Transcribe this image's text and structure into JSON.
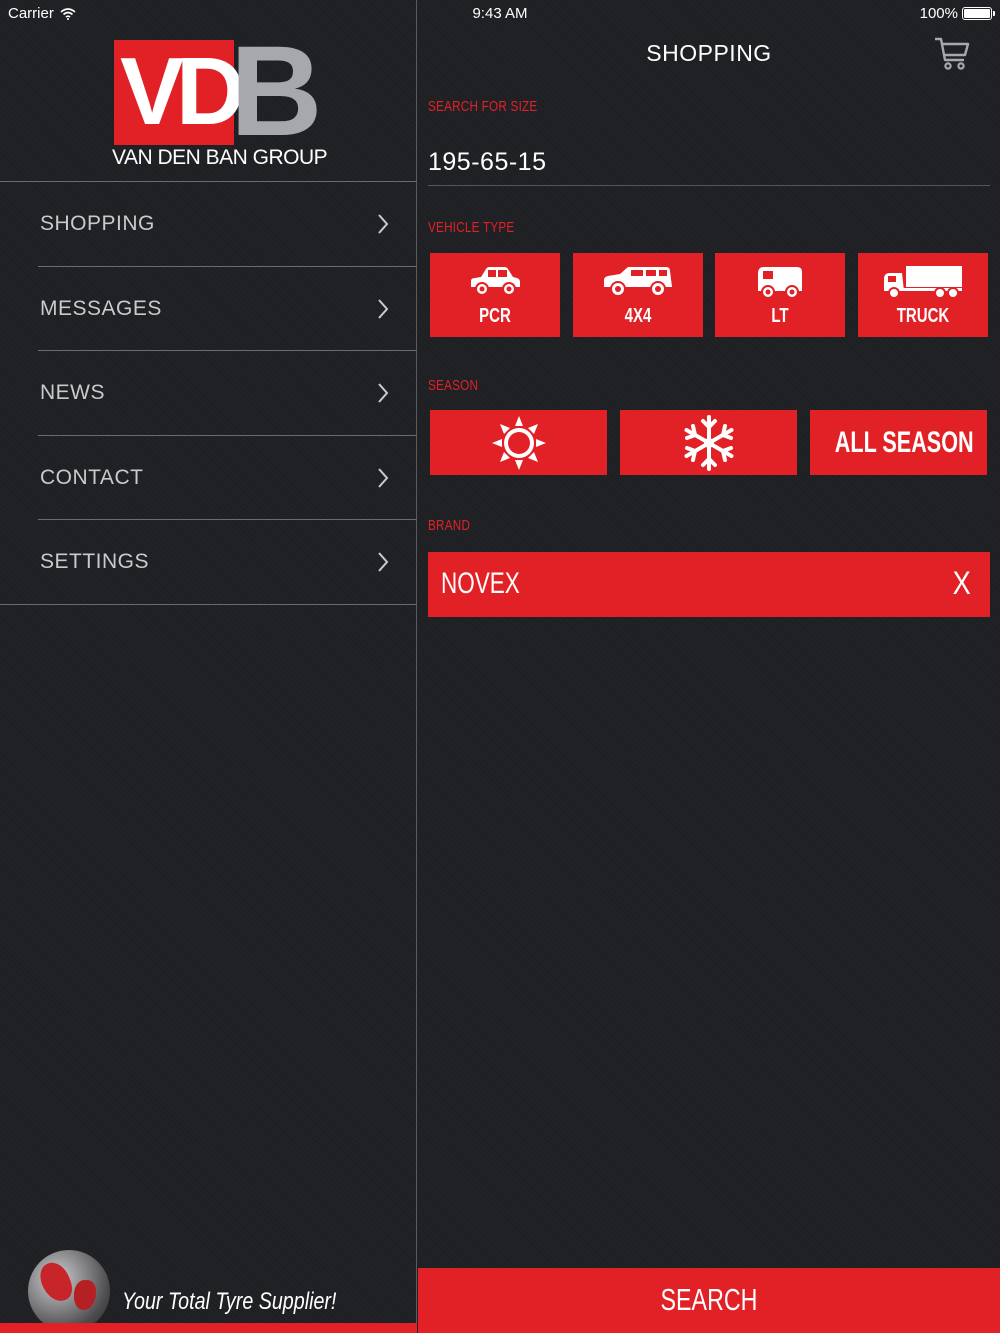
{
  "status_bar": {
    "carrier": "Carrier",
    "time": "9:43 AM",
    "battery": "100%"
  },
  "brand": {
    "logo_letters": "VDB",
    "group_name": "VAN DEN BAN GROUP",
    "tagline": "Your Total Tyre Supplier!",
    "accent_color": "#e22126"
  },
  "sidebar": {
    "items": [
      {
        "label": "SHOPPING"
      },
      {
        "label": "MESSAGES"
      },
      {
        "label": "NEWS"
      },
      {
        "label": "CONTACT"
      },
      {
        "label": "SETTINGS"
      }
    ]
  },
  "main": {
    "title": "SHOPPING",
    "size_label": "SEARCH FOR SIZE",
    "size_value": "195-65-15",
    "vehicle_label": "VEHICLE TYPE",
    "vehicles": [
      {
        "label": "PCR",
        "icon": "car-icon"
      },
      {
        "label": "4X4",
        "icon": "suv-icon"
      },
      {
        "label": "LT",
        "icon": "van-icon"
      },
      {
        "label": "TRUCK",
        "icon": "truck-icon"
      }
    ],
    "season_label": "SEASON",
    "seasons": [
      {
        "icon": "sun-icon"
      },
      {
        "icon": "snowflake-icon"
      },
      {
        "label": "ALL SEASON"
      }
    ],
    "brand_label": "BRAND",
    "brand_value": "NOVEX",
    "brand_clear": "X",
    "search_label": "SEARCH"
  }
}
